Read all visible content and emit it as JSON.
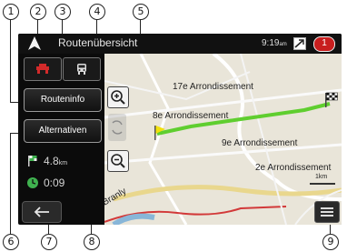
{
  "screen": {
    "title": "Routenübersicht",
    "clock": "9:19",
    "clock_suffix": "am",
    "notification_count": "1",
    "tabs": [
      {
        "icon": "car-icon"
      },
      {
        "icon": "truck-icon"
      }
    ],
    "buttons": {
      "route_info": "Routeninfo",
      "alternatives": "Alternativen"
    },
    "stats": {
      "distance_value": "4.8",
      "distance_unit": "km",
      "time": "0:09"
    },
    "map": {
      "labels": [
        "17e Arrondissement",
        "8e Arrondissement",
        "9e Arrondissement",
        "2e Arrondissement",
        "Branly"
      ],
      "scale_label": "1km"
    }
  },
  "callouts": [
    "1",
    "2",
    "3",
    "4",
    "5",
    "6",
    "7",
    "8",
    "9"
  ],
  "colors": {
    "route": "#5fce2f",
    "background": "#0b0b0b",
    "flag": "#f2e10c"
  }
}
